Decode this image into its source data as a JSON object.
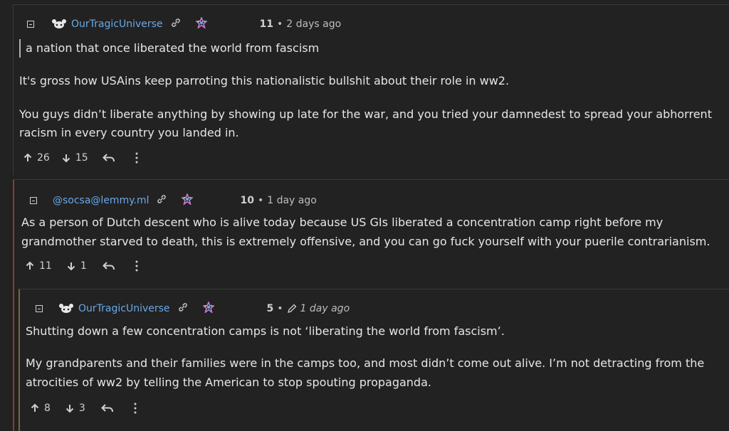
{
  "comments": [
    {
      "username": "OurTragicUniverse",
      "score": "11",
      "time": "2 days ago",
      "quote": "a nation that once liberated the world from fascism",
      "paragraphs": [
        "It's gross how USAins keep parroting this nationalistic bullshit about their role in ww2.",
        "You guys didn’t liberate anything by showing up late for the war, and you tried your damnedest to spread your abhorrent",
        "racism in every country you landed in."
      ],
      "upvotes": "26",
      "downvotes": "15"
    },
    {
      "username": "@socsa@lemmy.ml",
      "score": "10",
      "time": "1 day ago",
      "paragraphs": [
        "As a person of Dutch descent who is alive today because US GIs liberated a concentration camp right before my",
        "grandmother starved to death, this is extremely offensive, and you can go fuck yourself with your puerile contrarianism."
      ],
      "upvotes": "11",
      "downvotes": "1"
    },
    {
      "username": "OurTragicUniverse",
      "score": "5",
      "time": "1 day ago",
      "edited": true,
      "paragraphs": [
        "Shutting down a few concentration camps is not ‘liberating the world from fascism’.",
        "My grandparents and their families were in the camps too, and most didn’t come out alive. I’m not detracting from the",
        "atrocities of ww2 by telling the American to stop spouting propaganda."
      ],
      "upvotes": "8",
      "downvotes": "3"
    }
  ],
  "separator": "•",
  "icons": {
    "collapse": "collapse-icon",
    "avatar": "avatar-icon",
    "link": "link-icon",
    "fediverse": "fediverse-icon",
    "edit": "pencil-icon",
    "upvote": "arrow-up-icon",
    "downvote": "arrow-down-icon",
    "reply": "reply-icon",
    "more": "more-vertical-icon"
  },
  "colors": {
    "background": "#222222",
    "username": "#6aa8e8",
    "text": "#e6e6e6",
    "thread_border_1": "#8a3a3a",
    "thread_border_2": "#7a6a2a"
  }
}
